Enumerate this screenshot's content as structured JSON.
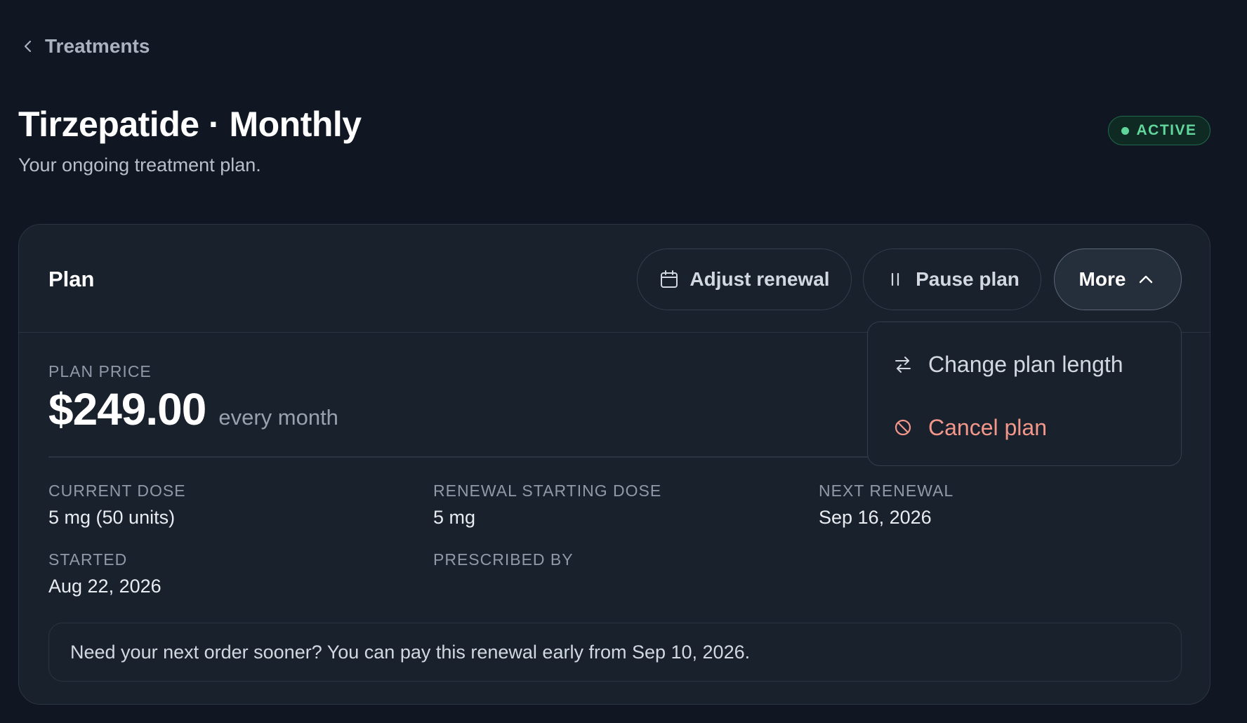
{
  "breadcrumb": {
    "label": "Treatments",
    "icon": "chevron-left-icon"
  },
  "header": {
    "title": "Tirzepatide · Monthly",
    "subtitle": "Your ongoing treatment plan.",
    "status": "ACTIVE"
  },
  "plan": {
    "title": "Plan",
    "actions": {
      "adjust_renewal": "Adjust renewal",
      "pause_plan": "Pause plan",
      "more": "More"
    },
    "menu": {
      "change_plan_length": "Change plan length",
      "cancel_plan": "Cancel plan"
    },
    "price_label": "PLAN PRICE",
    "price": "$249.00",
    "period": "every month",
    "fields": {
      "current_dose_label": "CURRENT DOSE",
      "current_dose": "5 mg (50 units)",
      "renewal_dose_label": "RENEWAL STARTING DOSE",
      "renewal_dose": "5 mg",
      "next_renewal_label": "NEXT RENEWAL",
      "next_renewal": "Sep 16, 2026",
      "started_label": "STARTED",
      "started": "Aug 22, 2026",
      "prescribed_by_label": "PRESCRIBED BY",
      "prescribed_by": ""
    },
    "note": "Need your next order sooner? You can pay this renewal early from Sep 10, 2026."
  },
  "colors": {
    "background": "#101722",
    "card": "#19212c",
    "active_green": "#62d79d",
    "danger": "#f2978a"
  }
}
